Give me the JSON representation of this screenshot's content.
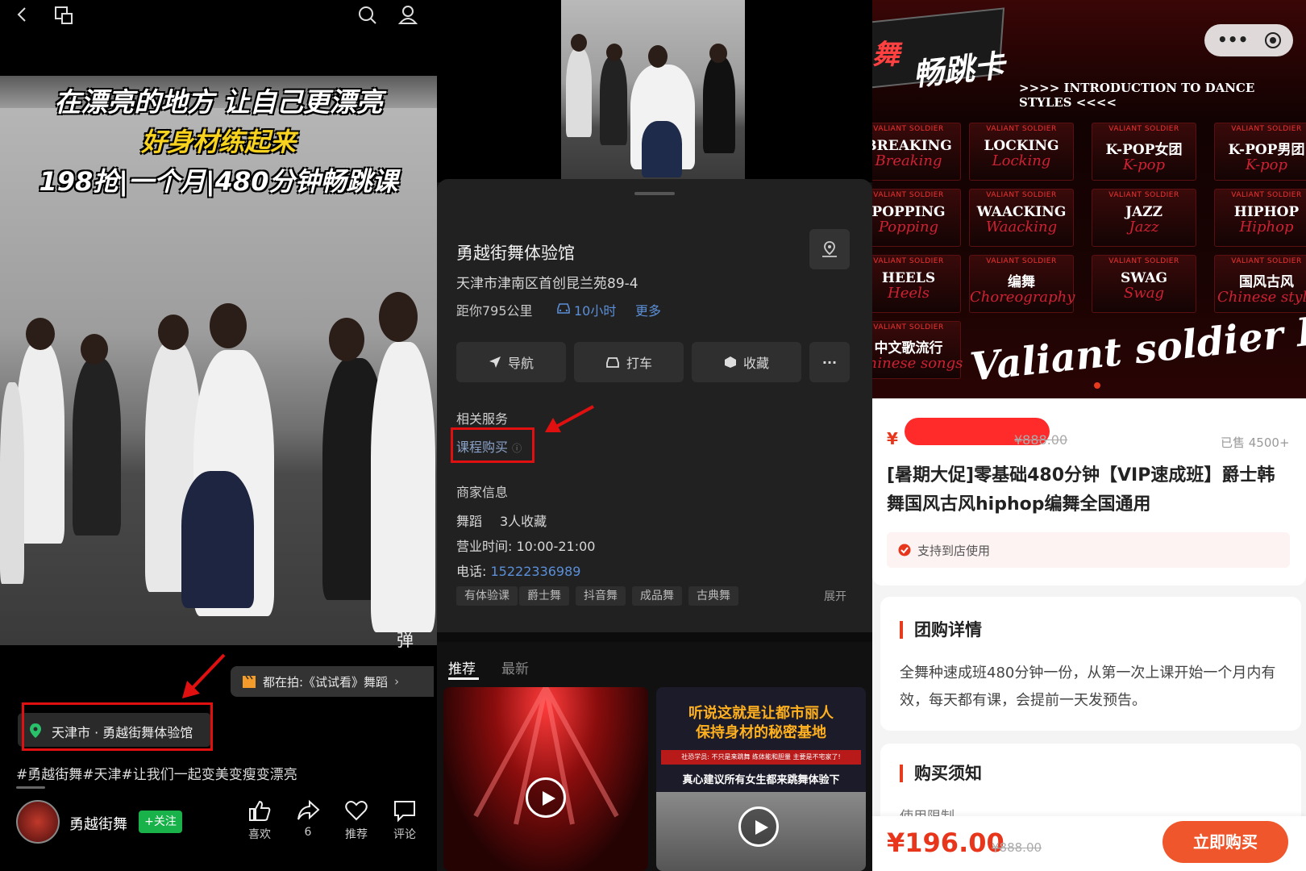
{
  "panel1": {
    "icons": [
      "back-icon",
      "window-icon",
      "search-icon",
      "user-icon"
    ],
    "video_title_1": "在漂亮的地方 让自己更漂亮",
    "video_title_2": "好身材练起来",
    "video_title_3": "198抢|一个月|480分钟畅跳课",
    "danmaku": "弹",
    "now_shooting": "都在拍:《试试看》舞蹈",
    "location_tag": "天津市 · 勇越街舞体验馆",
    "caption": "#勇越街舞#天津#让我们一起变美变瘦变漂亮",
    "author": "勇越街舞",
    "follow": "+关注",
    "actions": [
      {
        "label": "喜欢",
        "icon": "thumb-up-icon"
      },
      {
        "label": "6",
        "icon": "share-icon"
      },
      {
        "label": "推荐",
        "icon": "heart-icon"
      },
      {
        "label": "评论",
        "icon": "comment-icon"
      }
    ]
  },
  "panel2": {
    "venue_name": "勇越街舞体验馆",
    "address": "天津市津南区首创昆兰苑89-4",
    "distance": "距你795公里",
    "drive_time": "10小时",
    "more": "更多",
    "buttons": {
      "nav": "导航",
      "taxi": "打车",
      "fav": "收藏",
      "more": "···"
    },
    "related_services": "相关服务",
    "course_buy": "课程购买",
    "merchant_info": "商家信息",
    "category": "舞蹈",
    "favorites": "3人收藏",
    "hours": "营业时间: 10:00-21:00",
    "phone_label": "电话: ",
    "phone": "15222336989",
    "tags": [
      "有体验课",
      "爵士舞",
      "抖音舞",
      "成品舞",
      "古典舞"
    ],
    "expand": "展开",
    "tabs": [
      "推荐",
      "最新"
    ],
    "card2_title_1": "听说这就是让都市丽人",
    "card2_title_2": "保持身材的秘密基地",
    "card2_sub": "社恐学员: 不只是来跳舞 练体能和胆量 主要是不宅家了!",
    "card2_title_3": "真心建议所有女生都来跳舞体验下"
  },
  "panel3": {
    "banner_tag": "舞",
    "banner_title": "畅跳卡",
    "banner_intro": ">>>> INTRODUCTION TO DANCE STYLES <<<<",
    "cell_caption": "VALIANT SOLDIER",
    "styles": [
      {
        "name": "BREAKING",
        "script": "Breaking"
      },
      {
        "name": "LOCKING",
        "script": "Locking"
      },
      {
        "name": "K-POP女团",
        "script": "K-pop"
      },
      {
        "name": "K-POP男团",
        "script": "K-pop"
      },
      {
        "name": "POPPING",
        "script": "Popping"
      },
      {
        "name": "WAACKING",
        "script": "Waacking"
      },
      {
        "name": "JAZZ",
        "script": "Jazz"
      },
      {
        "name": "HIPHOP",
        "script": "Hiphop"
      },
      {
        "name": "HEELS",
        "script": "Heels"
      },
      {
        "name": "编舞",
        "script": "Choreography"
      },
      {
        "name": "SWAG",
        "script": "Swag"
      },
      {
        "name": "国风古风",
        "script": "Chinese style"
      },
      {
        "name": "中文歌流行",
        "script": "Chinese songs"
      }
    ],
    "brand": "Valiant soldier Dance",
    "price_currency": "¥",
    "orig_price": "¥888.00",
    "sold": "已售 4500+",
    "product_title": "[暑期大促]零基础480分钟【VIP速成班】爵士韩舞国风古风hiphop编舞全国通用",
    "store_use": "支持到店使用",
    "group_detail_title": "团购详情",
    "group_detail_text": "全舞种速成班480分钟一份，从第一次上课开始一个月内有效，每天都有课，会提前一天发预告。",
    "notice_title": "购买须知",
    "notice_sub": "使用限制",
    "final_price": "¥196.00",
    "final_orig": "¥888.00",
    "buy_button": "立即购买",
    "colors": {
      "accent": "#e83a1c",
      "price": "#e8361c",
      "button": "#f0562b"
    }
  }
}
